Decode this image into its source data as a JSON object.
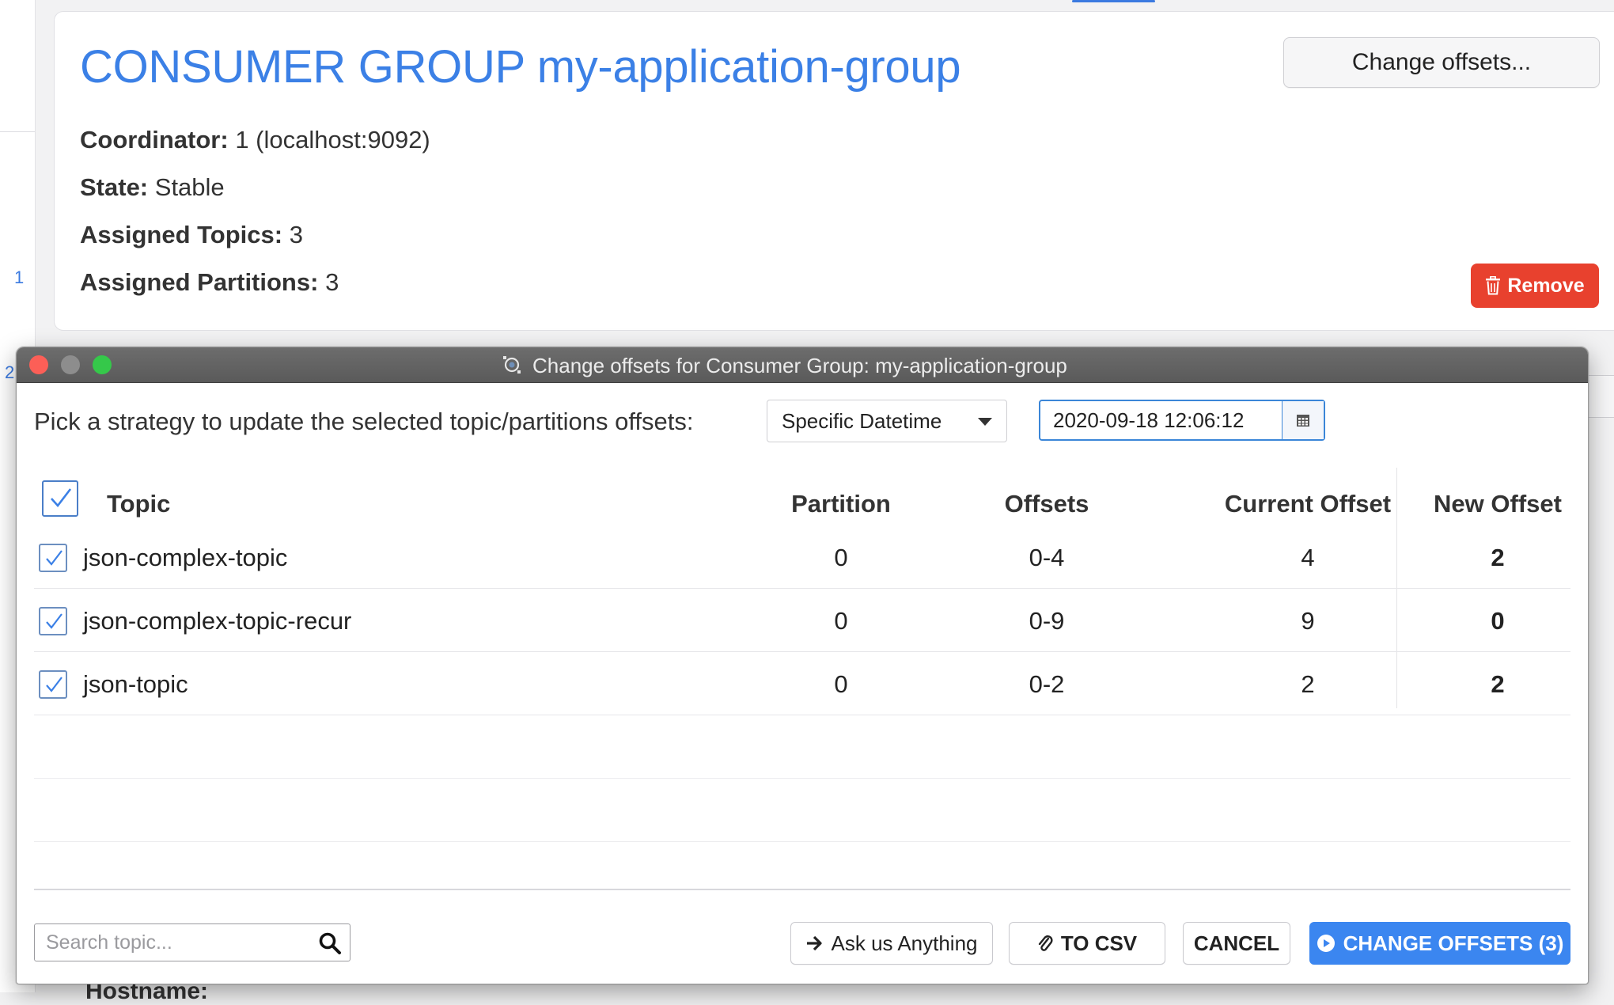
{
  "background": {
    "left_numbers": [
      "1",
      "2"
    ],
    "card": {
      "title": "CONSUMER GROUP my-application-group",
      "coordinator_label": "Coordinator:",
      "coordinator_value": "1 (localhost:9092)",
      "state_label": "State:",
      "state_value": "Stable",
      "assigned_topics_label": "Assigned Topics:",
      "assigned_topics_value": "3",
      "assigned_partitions_label": "Assigned Partitions:",
      "assigned_partitions_value": "3",
      "change_offsets_button": "Change offsets...",
      "remove_button": "Remove",
      "remove_icon": "trash-icon",
      "remove_color": "#e8412e",
      "title_color": "#3b80e6"
    },
    "hostname_stub": "Hostname:"
  },
  "modal": {
    "window_title": "Change offsets for Consumer Group: my-application-group",
    "strategy_label": "Pick a strategy to update the selected topic/partitions offsets:",
    "strategy_selected": "Specific Datetime",
    "datetime_value": "2020-09-18 12:06:12",
    "table": {
      "headers": {
        "topic": "Topic",
        "partition": "Partition",
        "offsets": "Offsets",
        "current_offset": "Current Offset",
        "new_offset": "New Offset"
      },
      "select_all_checked": true,
      "rows": [
        {
          "checked": true,
          "topic": "json-complex-topic",
          "partition": "0",
          "offsets": "0-4",
          "current_offset": "4",
          "new_offset": "2"
        },
        {
          "checked": true,
          "topic": "json-complex-topic-recur",
          "partition": "0",
          "offsets": "0-9",
          "current_offset": "9",
          "new_offset": "0"
        },
        {
          "checked": true,
          "topic": "json-topic",
          "partition": "0",
          "offsets": "0-2",
          "current_offset": "2",
          "new_offset": "2"
        }
      ]
    },
    "footer": {
      "search_placeholder": "Search topic...",
      "ask_button": "Ask us Anything",
      "csv_button": "TO CSV",
      "cancel_button": "CANCEL",
      "change_offsets_button": "CHANGE OFFSETS (3)",
      "primary_color": "#3b86f0"
    }
  }
}
